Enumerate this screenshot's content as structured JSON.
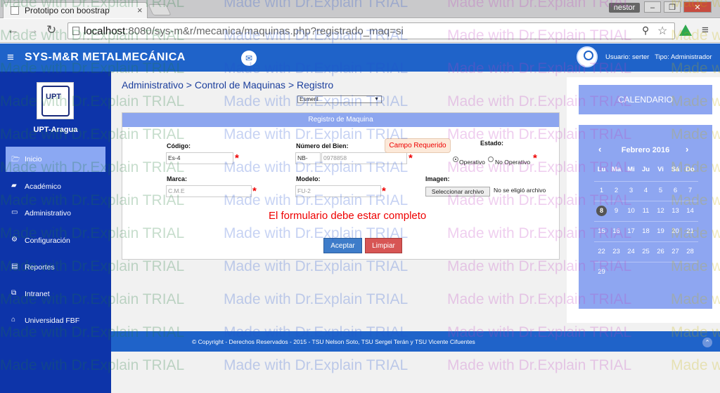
{
  "browser": {
    "tab_title": "Prototipo con boostrap",
    "user_badge": "nestor",
    "url_host": "localhost",
    "url_rest": ":8080/sys-m&r/mecanica/maquinas.php?registrado_maq=si"
  },
  "header": {
    "brand": "SYS-M&R  METALMECÁNICA",
    "user": "Usuario: serter",
    "type": "Tipo: Administrador"
  },
  "sidebar": {
    "logo_text": "UPT",
    "campus": "UPT-Aragua",
    "items": [
      {
        "label": "Inicio"
      },
      {
        "label": "Académico"
      },
      {
        "label": "Administrativo"
      },
      {
        "label": "Configuración"
      },
      {
        "label": "Reportes"
      },
      {
        "label": "Intranet"
      },
      {
        "label": "Universidad FBF"
      }
    ]
  },
  "main": {
    "breadcrumb": "Administrativo > Control de Maquinas > Registro",
    "select_value": "Esmeril",
    "panel_title": "Registro de Maquina",
    "labels": {
      "codigo": "Código:",
      "numero": "Número del Bien:",
      "estado": "Estado:",
      "marca": "Marca:",
      "modelo": "Modelo:",
      "imagen": "Imagen:"
    },
    "values": {
      "codigo": "Es-4",
      "numero_prefix": "NB-",
      "numero": "0978858",
      "marca": "C.M.E",
      "modelo": "FU-2"
    },
    "tooltip": "Campo Requerido",
    "estado_options": [
      "Operativo",
      "No Operativo"
    ],
    "file_button": "Seleccionar archivo",
    "file_status": "No se eligió archivo",
    "error": "El formulario debe estar completo",
    "btn_accept": "Aceptar",
    "btn_clear": "Limpiar"
  },
  "calendar": {
    "title": "CALENDARIO",
    "month": "Febrero 2016",
    "days": [
      "Lu",
      "Ma",
      "Mi",
      "Ju",
      "Vi",
      "Sá",
      "Do"
    ],
    "weeks": [
      [
        "1",
        "2",
        "3",
        "4",
        "5",
        "6",
        "7"
      ],
      [
        "8",
        "9",
        "10",
        "11",
        "12",
        "13",
        "14"
      ],
      [
        "15",
        "16",
        "17",
        "18",
        "19",
        "20",
        "21"
      ],
      [
        "22",
        "23",
        "24",
        "25",
        "26",
        "27",
        "28"
      ],
      [
        "29",
        "",
        "",
        "",
        "",
        "",
        ""
      ]
    ],
    "today": "8"
  },
  "footer": {
    "text": "© Copyright - Derechos Reservados - 2015 - TSU Nelson Soto, TSU Sergei Terán y TSU Vicente Cifuentes"
  },
  "watermark": "Made with Dr.Explain TRIAL"
}
